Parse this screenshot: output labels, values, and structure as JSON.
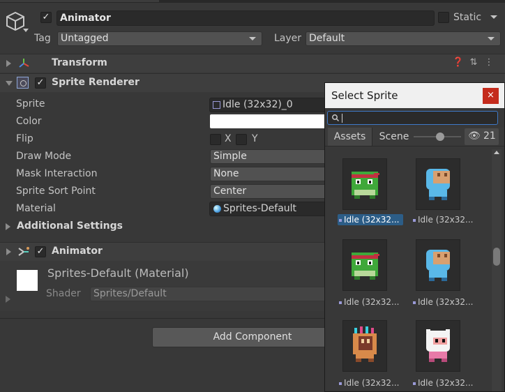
{
  "gameobject": {
    "name": "Animator",
    "static_label": "Static",
    "tag_label": "Tag",
    "tag_value": "Untagged",
    "layer_label": "Layer",
    "layer_value": "Default"
  },
  "components": {
    "transform": "Transform",
    "sprite_renderer": "Sprite Renderer",
    "animator": "Animator"
  },
  "sprite_renderer": {
    "fields": [
      {
        "label": "Sprite",
        "value": "Idle (32x32)_0"
      },
      {
        "label": "Color",
        "value": ""
      },
      {
        "label": "Flip",
        "value": ""
      },
      {
        "label": "Draw Mode",
        "value": "Simple"
      },
      {
        "label": "Mask Interaction",
        "value": "None"
      },
      {
        "label": "Sprite Sort Point",
        "value": "Center"
      },
      {
        "label": "Material",
        "value": "Sprites-Default"
      }
    ],
    "flip_x": "X",
    "flip_y": "Y",
    "additional_settings": "Additional Settings"
  },
  "material": {
    "name": "Sprites-Default (Material)",
    "shader_label": "Shader",
    "shader_value": "Sprites/Default"
  },
  "add_component": "Add Component",
  "select_sprite": {
    "title": "Select Sprite",
    "close": "×",
    "search_placeholder": "",
    "tabs": [
      "Assets",
      "Scene"
    ],
    "hidden_count": "21",
    "items": [
      {
        "label": "Idle (32x32...",
        "character": "ninja-frog",
        "selected": true
      },
      {
        "label": "Idle (32x32...",
        "character": "mask-dude",
        "selected": false
      },
      {
        "label": "Idle (32x32...",
        "character": "ninja-frog",
        "selected": false
      },
      {
        "label": "Idle (32x32...",
        "character": "mask-dude",
        "selected": false
      },
      {
        "label": "Idle (32x32...",
        "character": "virtual-guy",
        "selected": false
      },
      {
        "label": "Idle (32x32...",
        "character": "pink-man",
        "selected": false
      }
    ]
  },
  "colors": {
    "accent": "#3e79c8",
    "selection": "#2c5d87",
    "close_red": "#c42b1c"
  }
}
